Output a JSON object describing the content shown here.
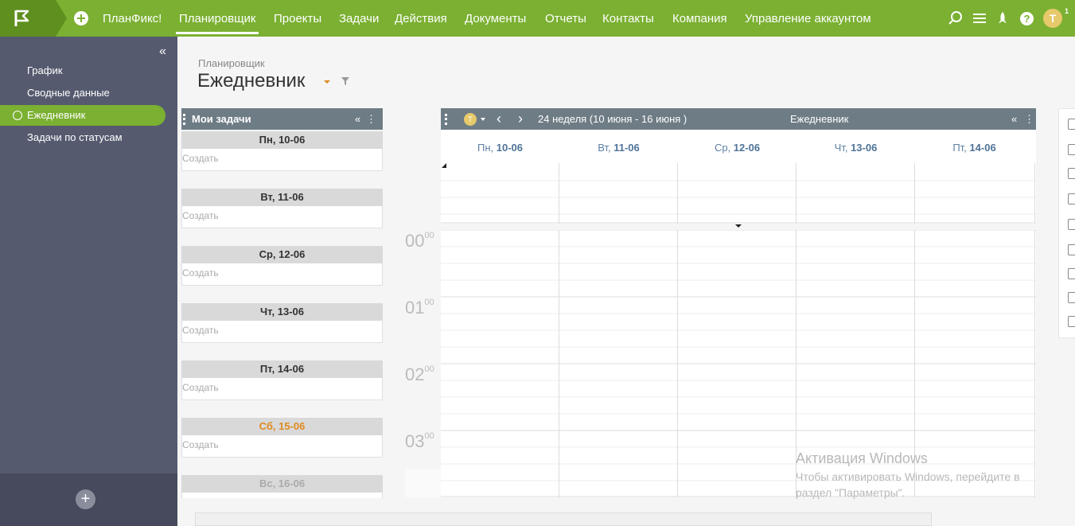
{
  "nav": {
    "brand": "ПланФикс!",
    "items": [
      "Планировщик",
      "Проекты",
      "Задачи",
      "Действия",
      "Документы",
      "Отчеты",
      "Контакты",
      "Компания",
      "Управление аккаунтом"
    ],
    "active_item": "Планировщик",
    "user_initial": "T",
    "notification_count": "1",
    "accent_color": "#7bb032"
  },
  "sidebar": {
    "items": [
      "График",
      "Сводные данные",
      "Ежедневник",
      "Задачи по статусам"
    ],
    "active_item": "Ежедневник"
  },
  "page": {
    "breadcrumb": "Планировщик",
    "title": "Ежедневник"
  },
  "tasks_panel": {
    "title": "Мои задачи",
    "days": [
      {
        "label": "Пн, 10-06",
        "create": "Создать"
      },
      {
        "label": "Вт, 11-06",
        "create": "Создать"
      },
      {
        "label": "Ср, 12-06",
        "create": "Создать"
      },
      {
        "label": "Чт, 13-06",
        "create": "Создать"
      },
      {
        "label": "Пт, 14-06",
        "create": "Создать"
      },
      {
        "label": "Сб, 15-06",
        "create": "Создать"
      },
      {
        "label": "Вс, 16-06",
        "create": ""
      }
    ]
  },
  "calendar": {
    "user_initial": "T",
    "week_label": "24 неделя  (10 июня - 16 июня )",
    "title": "Ежедневник",
    "days": [
      {
        "weekday": "Пн,",
        "date": "10-06"
      },
      {
        "weekday": "Вт,",
        "date": "11-06"
      },
      {
        "weekday": "Ср,",
        "date": "12-06"
      },
      {
        "weekday": "Чт,",
        "date": "13-06"
      },
      {
        "weekday": "Пт,",
        "date": "14-06"
      }
    ],
    "hours": [
      {
        "h": "00",
        "m": "00"
      },
      {
        "h": "01",
        "m": "00"
      },
      {
        "h": "02",
        "m": "00"
      },
      {
        "h": "03",
        "m": "00"
      }
    ]
  },
  "right_tools": [
    "calendar-icon",
    "clipboard-icon",
    "clipboard-icon",
    "clipboard-icon",
    "clipboard-icon",
    "clipboard-icon",
    "list-icon",
    "calendar-icon"
  ],
  "watermark": {
    "title": "Активация Windows",
    "line1": "Чтобы активировать Windows, перейдите в",
    "line2": "раздел \"Параметры\"."
  }
}
